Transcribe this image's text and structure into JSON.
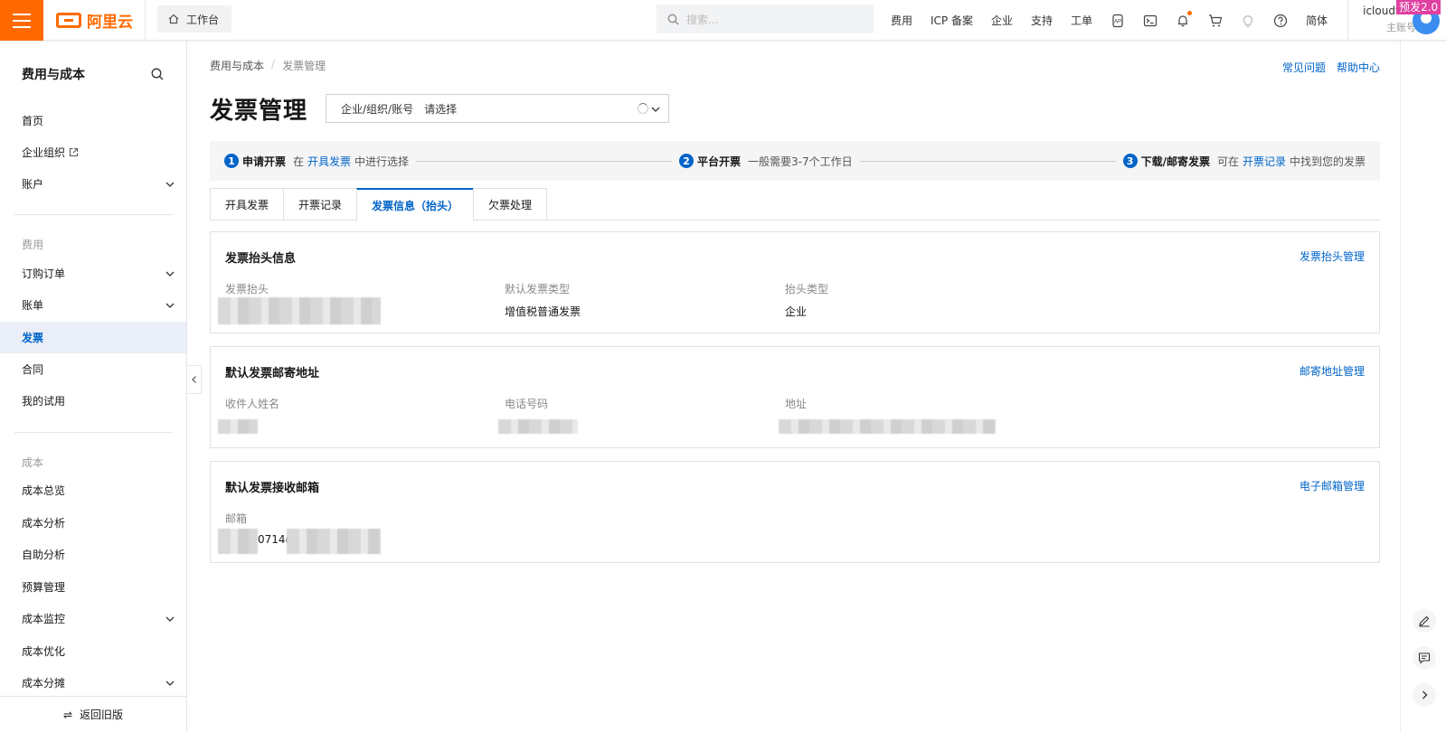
{
  "header": {
    "logo_text": "阿里云",
    "workbench": "工作台",
    "search_placeholder": "搜索...",
    "nav": [
      "费用",
      "ICP 备案",
      "企业",
      "支持",
      "工单"
    ],
    "language": "简体",
    "account_name": "icloudtest",
    "account_sub": "主账号",
    "prerelease_badge": "预发2.0"
  },
  "sidebar": {
    "title": "费用与成本",
    "items": [
      {
        "label": "首页"
      },
      {
        "label": "企业组织"
      },
      {
        "label": "账户"
      },
      {
        "label": "订购订单"
      },
      {
        "label": "账单"
      },
      {
        "label": "发票"
      },
      {
        "label": "合同"
      },
      {
        "label": "我的试用"
      },
      {
        "label": "成本总览"
      },
      {
        "label": "成本分析"
      },
      {
        "label": "自助分析"
      },
      {
        "label": "预算管理"
      },
      {
        "label": "成本监控"
      },
      {
        "label": "成本优化"
      },
      {
        "label": "成本分摊"
      }
    ],
    "group_fee": "费用",
    "group_cost": "成本",
    "bottom": "返回旧版"
  },
  "main": {
    "breadcrumb": [
      "费用与成本",
      "发票管理"
    ],
    "help": [
      "常见问题",
      "帮助中心"
    ],
    "title": "发票管理",
    "selector_label": "企业/组织/账号",
    "selector_value": "请选择",
    "steps": [
      {
        "num": "1",
        "title": "申请开票",
        "pre": "在",
        "link": "开具发票",
        "post": "中进行选择"
      },
      {
        "num": "2",
        "title": "平台开票",
        "pre": "一般需要3-7个工作日",
        "link": "",
        "post": ""
      },
      {
        "num": "3",
        "title": "下载/邮寄发票",
        "pre": "可在",
        "link": "开票记录",
        "post": "中找到您的发票"
      }
    ],
    "tabs": [
      "开具发票",
      "开票记录",
      "发票信息（抬头）",
      "欠票处理"
    ],
    "cards": [
      {
        "title": "发票抬头信息",
        "action": "发票抬头管理",
        "fields": [
          {
            "label": "发票抬头",
            "value": ""
          },
          {
            "label": "默认发票类型",
            "value": "增值税普通发票"
          },
          {
            "label": "抬头类型",
            "value": "企业"
          }
        ]
      },
      {
        "title": "默认发票邮寄地址",
        "action": "邮寄地址管理",
        "fields": [
          {
            "label": "收件人姓名",
            "value": ""
          },
          {
            "label": "电话号码",
            "value": ""
          },
          {
            "label": "地址",
            "value": ""
          }
        ]
      },
      {
        "title": "默认发票接收邮箱",
        "action": "电子邮箱管理",
        "fields": [
          {
            "label": "邮箱",
            "value": "0714@"
          }
        ]
      }
    ]
  }
}
